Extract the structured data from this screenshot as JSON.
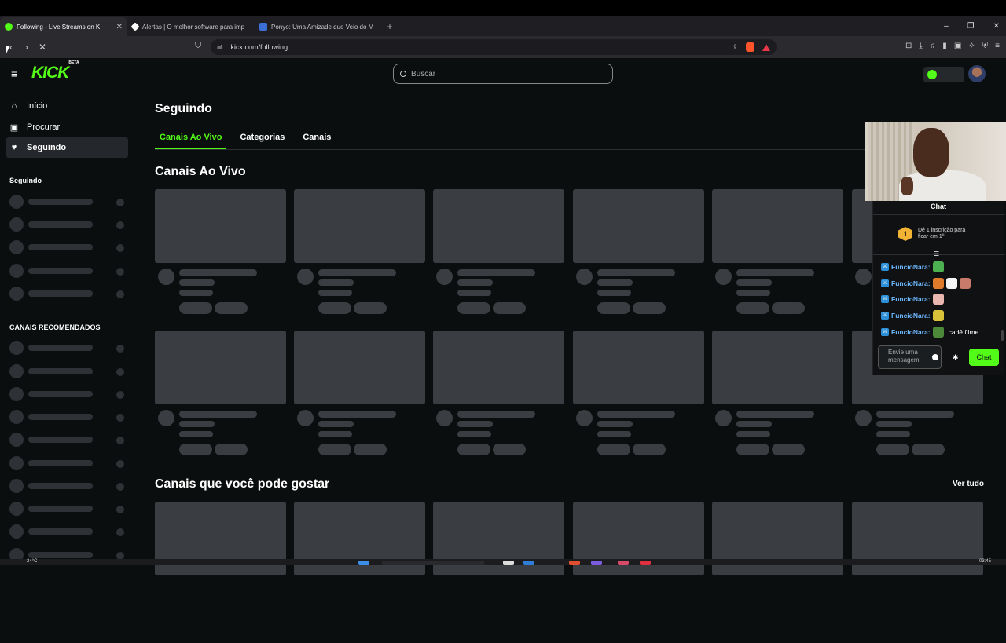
{
  "browser": {
    "tabs": [
      {
        "title": "Following - Live Streams on K",
        "active": true,
        "favicon_color": "#53fc18"
      },
      {
        "title": "Alertas | O melhor software para imp",
        "active": false,
        "favicon_color": "#ffffff"
      },
      {
        "title": "Ponyo: Uma Amizade que Veio do M",
        "active": false,
        "favicon_color": "#3b6fd6"
      }
    ],
    "new_tab_label": "+",
    "url": "kick.com/following",
    "window_controls": [
      "–",
      "❐",
      "✕"
    ]
  },
  "header": {
    "logo": "KICK",
    "logo_badge": "BETA",
    "search_placeholder": "Buscar",
    "brand_color": "#53fc18"
  },
  "sidebar": {
    "nav": [
      {
        "label": "Início",
        "icon": "home-icon",
        "active": false
      },
      {
        "label": "Procurar",
        "icon": "browse-icon",
        "active": false
      },
      {
        "label": "Seguindo",
        "icon": "heart-icon",
        "active": true
      }
    ],
    "following_heading": "Seguindo",
    "recommended_heading": "CANAIS RECOMENDADOS"
  },
  "main": {
    "title": "Seguindo",
    "tabs": [
      {
        "label": "Canais Ao Vivo",
        "active": true
      },
      {
        "label": "Categorias",
        "active": false
      },
      {
        "label": "Canais",
        "active": false
      }
    ],
    "section_live": "Canais Ao Vivo",
    "section_recommended": "Canais que você pode gostar",
    "see_all": "Ver tudo"
  },
  "chat": {
    "title": "Chat",
    "sub_badge": "1",
    "sub_text": "Dê 1 inscrição para ficar em 1º",
    "messages": [
      {
        "user": "FuncioNara:",
        "text": "",
        "emotes": [
          "#4caf50"
        ]
      },
      {
        "user": "FuncioNara:",
        "text": "",
        "emotes": [
          "#e07a2b",
          "#f5f5f5",
          "#c97b6b"
        ]
      },
      {
        "user": "FuncioNara:",
        "text": "",
        "emotes": [
          "#e8b7b0"
        ]
      },
      {
        "user": "FuncioNara:",
        "text": "",
        "emotes": [
          "#d8c23a"
        ]
      },
      {
        "user": "FuncioNara:",
        "text": "cadê filme",
        "emotes": [
          "#4c8a3a"
        ]
      }
    ],
    "input_placeholder": "Envie uma mensagem",
    "send_label": "Chat"
  },
  "taskbar": {
    "weather": "24°C",
    "clock": "03:45"
  }
}
